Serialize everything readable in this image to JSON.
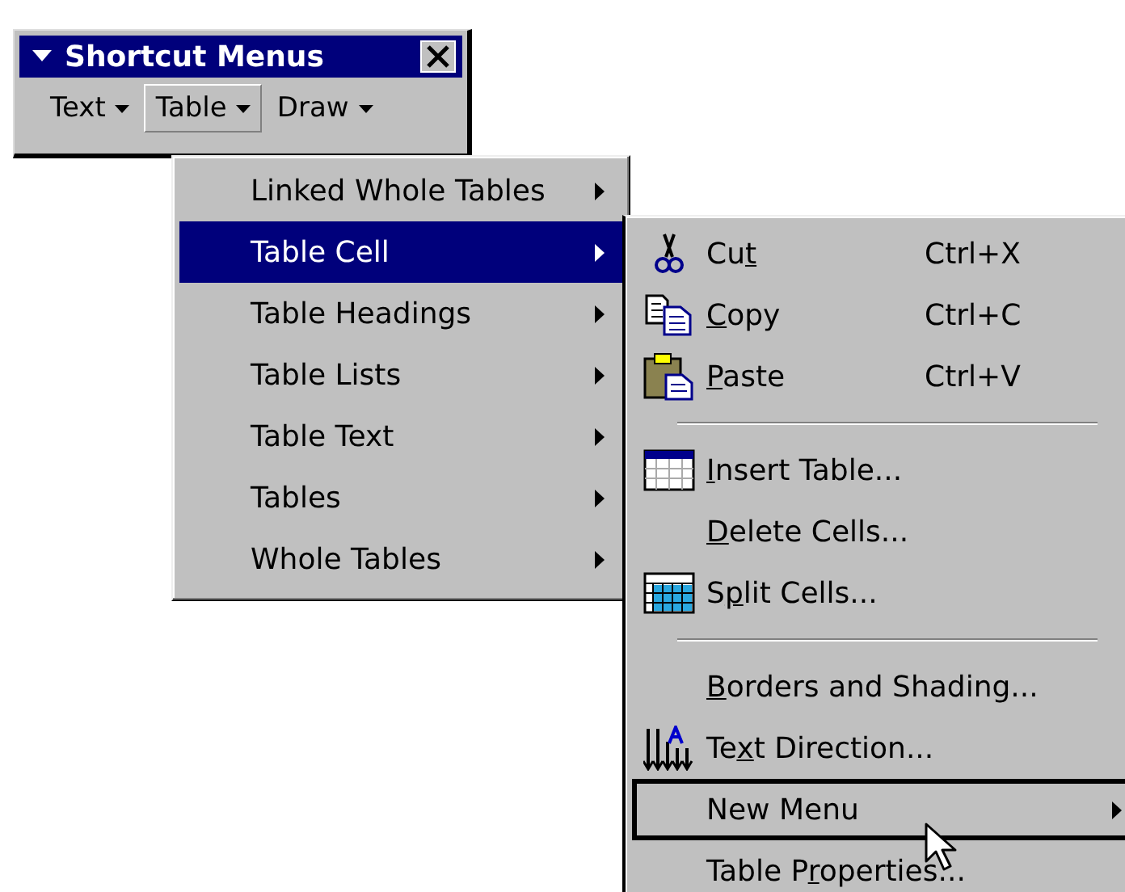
{
  "toolbar": {
    "title": "Shortcut Menus",
    "menus": [
      {
        "label": "Text",
        "selected": false
      },
      {
        "label": "Table",
        "selected": true
      },
      {
        "label": "Draw",
        "selected": false
      }
    ]
  },
  "menu": {
    "items": [
      {
        "label": "Linked Whole Tables",
        "selected": false,
        "submenu": true
      },
      {
        "label": "Table Cell",
        "selected": true,
        "submenu": true
      },
      {
        "label": "Table Headings",
        "selected": false,
        "submenu": true
      },
      {
        "label": "Table Lists",
        "selected": false,
        "submenu": true
      },
      {
        "label": "Table Text",
        "selected": false,
        "submenu": true
      },
      {
        "label": "Tables",
        "selected": false,
        "submenu": true
      },
      {
        "label": "Whole Tables",
        "selected": false,
        "submenu": true
      }
    ]
  },
  "submenu": {
    "items": [
      {
        "kind": "command",
        "before": "Cu",
        "key": "t",
        "shortcut": "Ctrl+X",
        "selected": false,
        "submenu": false
      },
      {
        "kind": "command",
        "key": "C",
        "after": "opy",
        "shortcut": "Ctrl+C",
        "selected": false,
        "submenu": false
      },
      {
        "kind": "command",
        "key": "P",
        "after": "aste",
        "shortcut": "Ctrl+V",
        "selected": false,
        "submenu": false
      },
      {
        "kind": "separator"
      },
      {
        "kind": "command",
        "key": "I",
        "after": "nsert Table...",
        "selected": false,
        "submenu": false
      },
      {
        "kind": "command",
        "key": "D",
        "after": "elete Cells...",
        "selected": false,
        "submenu": false
      },
      {
        "kind": "command",
        "before": "S",
        "key": "p",
        "after": "lit Cells...",
        "selected": false,
        "submenu": false
      },
      {
        "kind": "separator"
      },
      {
        "kind": "command",
        "key": "B",
        "after": "orders and Shading...",
        "selected": false,
        "submenu": false
      },
      {
        "kind": "command",
        "before": "Te",
        "key": "x",
        "after": "t Direction...",
        "selected": false,
        "submenu": false
      },
      {
        "kind": "command",
        "before": "New Menu",
        "selected": true,
        "submenu": true
      },
      {
        "kind": "command",
        "before": "Table P",
        "key": "r",
        "after": "operties...",
        "selected": false,
        "submenu": false
      }
    ]
  }
}
